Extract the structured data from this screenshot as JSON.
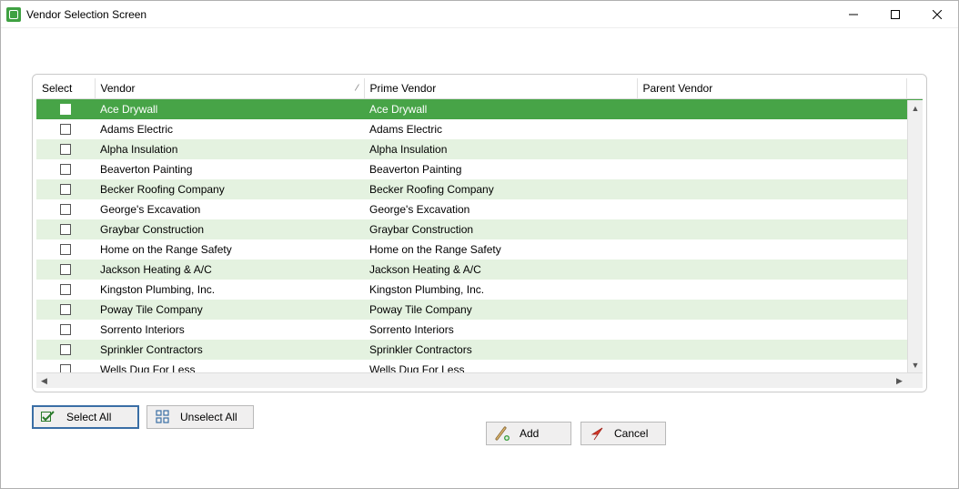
{
  "window": {
    "title": "Vendor Selection Screen"
  },
  "table": {
    "columns": {
      "select": "Select",
      "vendor": "Vendor",
      "prime": "Prime Vendor",
      "parent": "Parent Vendor"
    },
    "rows": [
      {
        "vendor": "Ace Drywall",
        "prime": "Ace Drywall",
        "parent": "",
        "selected": true
      },
      {
        "vendor": "Adams Electric",
        "prime": "Adams Electric",
        "parent": "",
        "selected": false
      },
      {
        "vendor": "Alpha Insulation",
        "prime": "Alpha Insulation",
        "parent": "",
        "selected": false
      },
      {
        "vendor": "Beaverton Painting",
        "prime": "Beaverton Painting",
        "parent": "",
        "selected": false
      },
      {
        "vendor": "Becker Roofing Company",
        "prime": "Becker Roofing Company",
        "parent": "",
        "selected": false
      },
      {
        "vendor": "George's Excavation",
        "prime": "George's Excavation",
        "parent": "",
        "selected": false
      },
      {
        "vendor": "Graybar Construction",
        "prime": "Graybar Construction",
        "parent": "",
        "selected": false
      },
      {
        "vendor": "Home on the Range Safety",
        "prime": "Home on the Range Safety",
        "parent": "",
        "selected": false
      },
      {
        "vendor": "Jackson Heating & A/C",
        "prime": "Jackson Heating & A/C",
        "parent": "",
        "selected": false
      },
      {
        "vendor": "Kingston Plumbing, Inc.",
        "prime": "Kingston Plumbing, Inc.",
        "parent": "",
        "selected": false
      },
      {
        "vendor": "Poway Tile Company",
        "prime": "Poway Tile Company",
        "parent": "",
        "selected": false
      },
      {
        "vendor": "Sorrento Interiors",
        "prime": "Sorrento Interiors",
        "parent": "",
        "selected": false
      },
      {
        "vendor": "Sprinkler Contractors",
        "prime": "Sprinkler Contractors",
        "parent": "",
        "selected": false
      },
      {
        "vendor": "Wells Dug For Less",
        "prime": "Wells Dug For Less",
        "parent": "",
        "selected": false
      }
    ]
  },
  "buttons": {
    "select_all": "Select All",
    "unselect_all": "Unselect All",
    "add": "Add",
    "cancel": "Cancel"
  }
}
